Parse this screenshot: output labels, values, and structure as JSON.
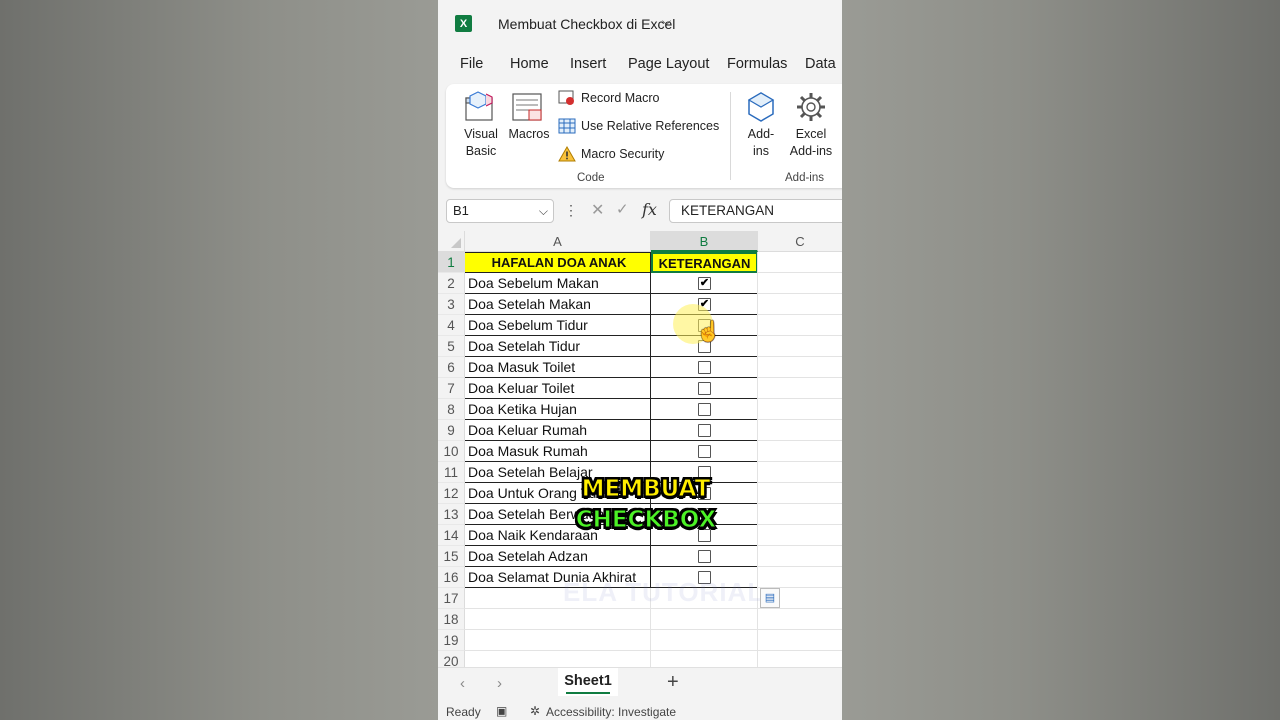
{
  "titlebar": {
    "title": "Membuat Checkbox di Excel",
    "app_icon": "excel-icon"
  },
  "tabs": [
    "File",
    "Home",
    "Insert",
    "Page Layout",
    "Formulas",
    "Data"
  ],
  "ribbon": {
    "visual_basic": "Visual Basic",
    "macros": "Macros",
    "record_macro": "Record Macro",
    "relative_refs": "Use Relative References",
    "macro_security": "Macro Security",
    "code_group": "Code",
    "addins": "Add-ins",
    "excel_addins": "Excel Add-ins",
    "addins_group": "Add-ins"
  },
  "formula_bar": {
    "name_box": "B1",
    "value": "KETERANGAN"
  },
  "columns": [
    "A",
    "B",
    "C"
  ],
  "header_row": {
    "a": "HAFALAN DOA ANAK",
    "b": "KETERANGAN"
  },
  "rows": [
    {
      "label": "Doa Sebelum Makan",
      "checked": true
    },
    {
      "label": "Doa Setelah Makan",
      "checked": true
    },
    {
      "label": "Doa Sebelum Tidur",
      "checked": false
    },
    {
      "label": "Doa Setelah Tidur",
      "checked": false
    },
    {
      "label": "Doa Masuk Toilet",
      "checked": false
    },
    {
      "label": "Doa Keluar Toilet",
      "checked": false
    },
    {
      "label": "Doa Ketika Hujan",
      "checked": false
    },
    {
      "label": "Doa Keluar Rumah",
      "checked": false
    },
    {
      "label": "Doa Masuk Rumah",
      "checked": false
    },
    {
      "label": "Doa Setelah Belajar",
      "checked": false
    },
    {
      "label": "Doa Untuk Orang Tua",
      "checked": false
    },
    {
      "label": "Doa Setelah Berwudhu",
      "checked": false
    },
    {
      "label": "Doa Naik Kendaraan",
      "checked": false
    },
    {
      "label": "Doa Setelah Adzan",
      "checked": false
    },
    {
      "label": "Doa Selamat Dunia Akhirat",
      "checked": false
    }
  ],
  "row_numbers": [
    "1",
    "2",
    "3",
    "4",
    "5",
    "6",
    "7",
    "8",
    "9",
    "10",
    "11",
    "12",
    "13",
    "14",
    "15",
    "16",
    "17",
    "18",
    "19",
    "20"
  ],
  "caption": {
    "line1": "MEMBUAT",
    "line2": "CHECKBOX"
  },
  "watermark": "ELA TUTORIAL",
  "sheet_tab": "Sheet1",
  "status": {
    "ready": "Ready",
    "accessibility": "Accessibility: Investigate"
  },
  "colors": {
    "excel_green": "#107c41",
    "header_fill": "#ffff00",
    "caption_yellow": "#ffee00",
    "caption_green": "#4cf226"
  }
}
